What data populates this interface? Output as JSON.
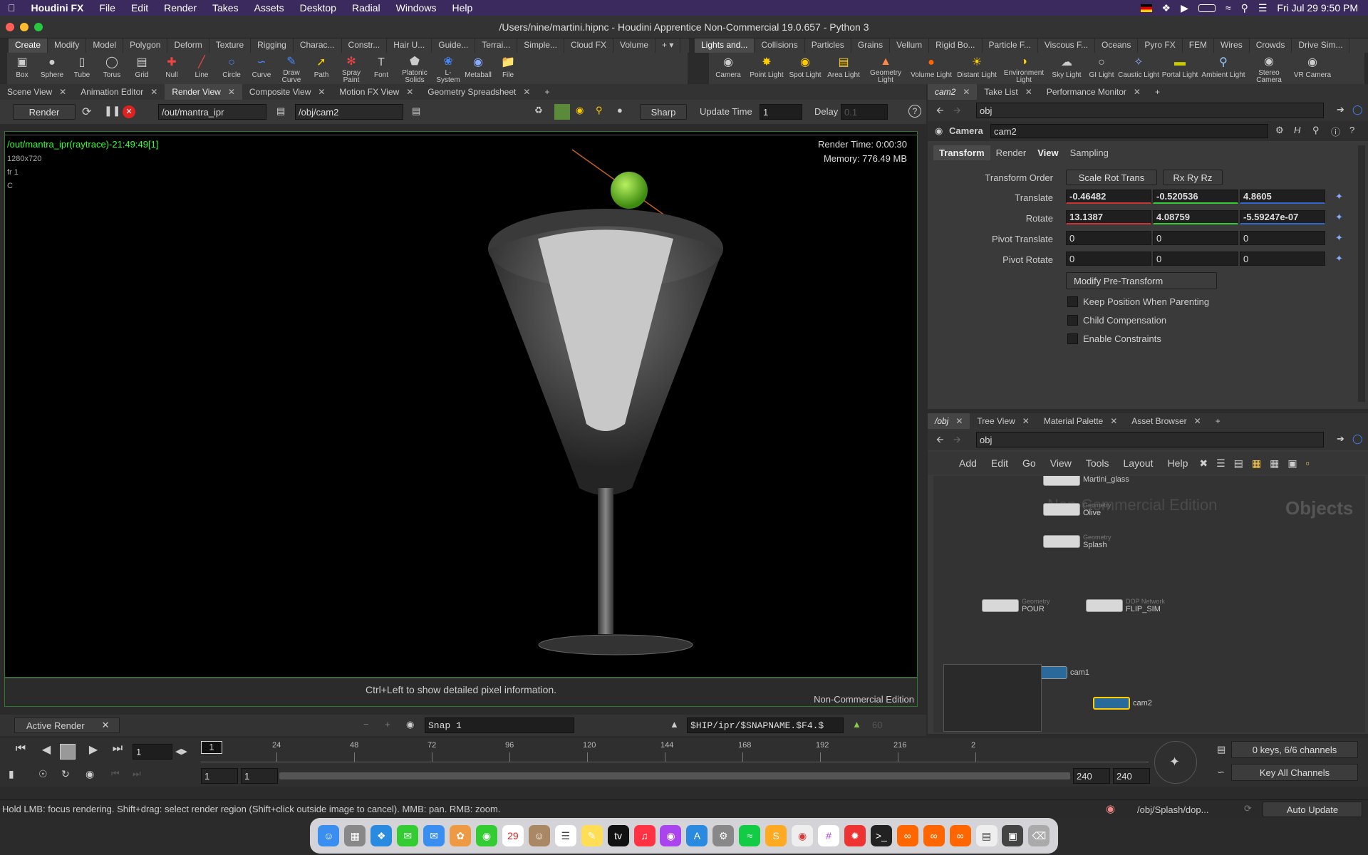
{
  "menubar": {
    "app": "Houdini FX",
    "items": [
      "File",
      "Edit",
      "Render",
      "Takes",
      "Assets",
      "Desktop",
      "Radial",
      "Windows",
      "Help"
    ],
    "clock": "Fri Jul 29  9:50 PM"
  },
  "window": {
    "title": "/Users/nine/martini.hipnc - Houdini Apprentice Non-Commercial 19.0.657 - Python 3"
  },
  "shelf_left": {
    "tabs": [
      "Create",
      "Modify",
      "Model",
      "Polygon",
      "Deform",
      "Texture",
      "Rigging",
      "Charac...",
      "Constr...",
      "Hair U...",
      "Guide...",
      "Terrai...",
      "Simple...",
      "Cloud FX",
      "Volume"
    ],
    "tools": [
      {
        "label": "Box",
        "icon": "box-icon"
      },
      {
        "label": "Sphere",
        "icon": "sphere-icon"
      },
      {
        "label": "Tube",
        "icon": "tube-icon"
      },
      {
        "label": "Torus",
        "icon": "torus-icon"
      },
      {
        "label": "Grid",
        "icon": "grid-icon"
      },
      {
        "label": "Null",
        "icon": "null-icon"
      },
      {
        "label": "Line",
        "icon": "line-icon"
      },
      {
        "label": "Circle",
        "icon": "circle-icon"
      },
      {
        "label": "Curve",
        "icon": "curve-icon"
      },
      {
        "label": "Draw Curve",
        "icon": "draw-curve-icon"
      },
      {
        "label": "Path",
        "icon": "path-icon"
      },
      {
        "label": "Spray Paint",
        "icon": "spray-paint-icon"
      },
      {
        "label": "Font",
        "icon": "font-icon"
      },
      {
        "label": "Platonic Solids",
        "icon": "platonic-icon"
      },
      {
        "label": "L-System",
        "icon": "lsystem-icon"
      },
      {
        "label": "Metaball",
        "icon": "metaball-icon"
      },
      {
        "label": "File",
        "icon": "file-icon"
      }
    ]
  },
  "shelf_right": {
    "tabs": [
      "Lights and...",
      "Collisions",
      "Particles",
      "Grains",
      "Vellum",
      "Rigid Bo...",
      "Particle F...",
      "Viscous F...",
      "Oceans",
      "Pyro FX",
      "FEM",
      "Wires",
      "Crowds",
      "Drive Sim..."
    ],
    "tools": [
      {
        "label": "Camera"
      },
      {
        "label": "Point Light"
      },
      {
        "label": "Spot Light"
      },
      {
        "label": "Area Light"
      },
      {
        "label": "Geometry Light"
      },
      {
        "label": "Volume Light"
      },
      {
        "label": "Distant Light"
      },
      {
        "label": "Environment Light"
      },
      {
        "label": "Sky Light"
      },
      {
        "label": "GI Light"
      },
      {
        "label": "Caustic Light"
      },
      {
        "label": "Portal Light"
      },
      {
        "label": "Ambient Light"
      },
      {
        "label": "Stereo Camera"
      },
      {
        "label": "VR Camera"
      }
    ]
  },
  "left_pane": {
    "tabs": [
      "Scene View",
      "Animation Editor",
      "Render View",
      "Composite View",
      "Motion FX View",
      "Geometry Spreadsheet"
    ],
    "active": "Render View"
  },
  "render_toolbar": {
    "render_label": "Render",
    "rop": "/out/mantra_ipr",
    "camera": "/obj/cam2",
    "filter": "Sharp",
    "update_time_label": "Update Time",
    "update_time": "1",
    "delay_label": "Delay",
    "delay": "0.1"
  },
  "viewer": {
    "render_name": "/out/mantra_ipr(raytrace)-21:49:49[1]",
    "resolution": "1280x720",
    "frame": "fr 1",
    "channel": "C",
    "render_time": "Render Time: 0:00:30",
    "memory": "Memory:   776.49 MB",
    "hint": "Ctrl+Left to show detailed pixel information.",
    "edition": "Non-Commercial Edition"
  },
  "snapshot_bar": {
    "active_render": "Active Render",
    "snap": "Snap 1",
    "path": "$HIP/ipr/$SNAPNAME.$F4.$",
    "num": "60"
  },
  "timeline": {
    "frame": "1",
    "ticks": [
      "24",
      "48",
      "72",
      "96",
      "120",
      "144",
      "168",
      "192",
      "216",
      "2"
    ],
    "range_start": "1",
    "range_start2": "1",
    "range_end": "240",
    "range_end2": "240",
    "keys": "0 keys, 6/6 channels",
    "key_all": "Key All Channels"
  },
  "status": {
    "message": "Hold LMB: focus rendering. Shift+drag: select render region (Shift+click outside image to cancel). MMB: pan. RMB: zoom.",
    "path": "/obj/Splash/dop...",
    "update": "Auto Update"
  },
  "param_pane": {
    "tabs": [
      "cam2",
      "Take List",
      "Performance Monitor"
    ],
    "path": "obj",
    "node_type": "Camera",
    "node_name": "cam2",
    "subtabs": [
      "Transform",
      "Render",
      "View",
      "Sampling"
    ],
    "transform_order_label": "Transform Order",
    "transform_order": "Scale Rot Trans",
    "rot_order": "Rx Ry Rz",
    "translate_label": "Translate",
    "translate": [
      "-0.46482",
      "-0.520536",
      "4.8605"
    ],
    "rotate_label": "Rotate",
    "rotate": [
      "13.1387",
      "4.08759",
      "-5.59247e-07"
    ],
    "pivot_translate_label": "Pivot Translate",
    "pivot_translate": [
      "0",
      "0",
      "0"
    ],
    "pivot_rotate_label": "Pivot Rotate",
    "pivot_rotate": [
      "0",
      "0",
      "0"
    ],
    "modify_pre": "Modify Pre-Transform",
    "checks": [
      "Keep Position When Parenting",
      "Child Compensation",
      "Enable Constraints"
    ]
  },
  "network_pane": {
    "tabs": [
      "/obj",
      "Tree View",
      "Material Palette",
      "Asset Browser"
    ],
    "path": "obj",
    "menu": [
      "Add",
      "Edit",
      "Go",
      "View",
      "Tools",
      "Layout",
      "Help"
    ],
    "watermark": "Non-Commercial Edition",
    "context": "Objects",
    "nodes": [
      {
        "name": "Martini_glass",
        "type": ""
      },
      {
        "name": "Olive",
        "type": "Geometry"
      },
      {
        "name": "Splash",
        "type": "Geometry"
      },
      {
        "name": "POUR",
        "type": "Geometry"
      },
      {
        "name": "FLIP_SIM",
        "type": "DOP Network"
      },
      {
        "name": "cam1",
        "type": ""
      },
      {
        "name": "cam2",
        "type": ""
      }
    ]
  }
}
